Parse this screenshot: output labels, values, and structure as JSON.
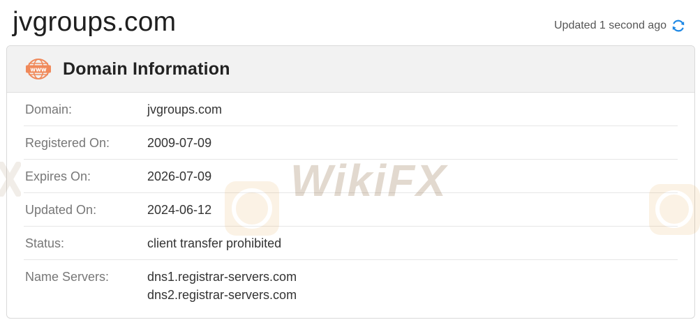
{
  "page": {
    "title": "jvgroups.com",
    "updated_text": "Updated 1 second ago"
  },
  "icons": {
    "refresh": "refresh-icon",
    "header": "www-icon"
  },
  "card": {
    "title": "Domain Information",
    "rows": [
      {
        "label": "Domain:",
        "value": "jvgroups.com"
      },
      {
        "label": "Registered On:",
        "value": "2009-07-09"
      },
      {
        "label": "Expires On:",
        "value": "2026-07-09"
      },
      {
        "label": "Updated On:",
        "value": "2024-06-12"
      },
      {
        "label": "Status:",
        "value": "client transfer prohibited"
      },
      {
        "label": "Name Servers:",
        "values": [
          "dns1.registrar-servers.com",
          "dns2.registrar-servers.com"
        ]
      }
    ]
  },
  "watermark": {
    "text": "WikiFX"
  },
  "colors": {
    "accent": "#1e88e5",
    "www_icon": "#f0895a"
  }
}
